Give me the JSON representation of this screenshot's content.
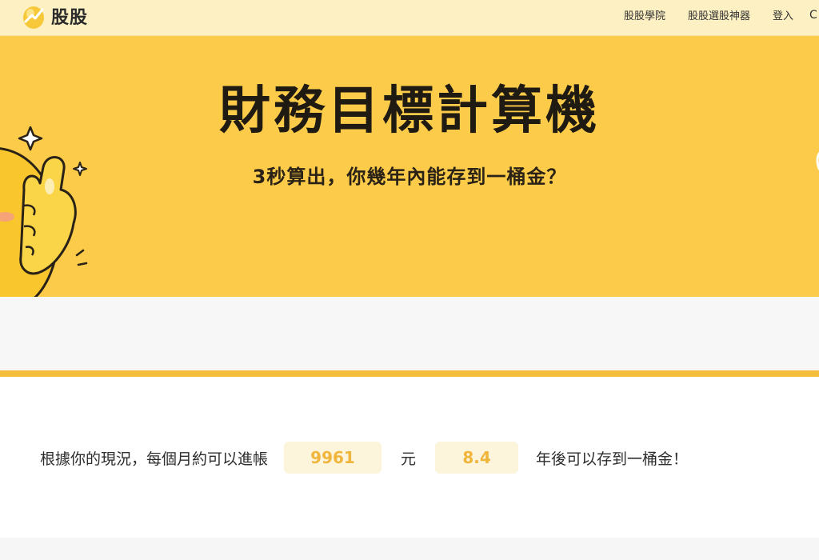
{
  "header": {
    "logo_text": "股股",
    "nav": [
      "股股學院",
      "股股選股神器",
      "登入"
    ],
    "more_glyph": "C"
  },
  "hero": {
    "title": "財務目標計算機",
    "subtitle": "3秒算出，你幾年內能存到一桶金？"
  },
  "result": {
    "prefix": "根據你的現況，每個月約可以進帳",
    "monthly_income": "9961",
    "unit": "元",
    "years": "8.4",
    "suffix": "年後可以存到一桶金！"
  },
  "colors": {
    "header_bg": "#fdf0c2",
    "hero_bg": "#fbcb49",
    "accent": "#f4be3c",
    "value_text": "#f0b53b",
    "value_bg": "#fdf4dc"
  },
  "icons": {
    "logo": "egg-logo-icon",
    "mascot": "thumbs-up-mascot-icon",
    "sparkles": "sparkle-icon"
  }
}
